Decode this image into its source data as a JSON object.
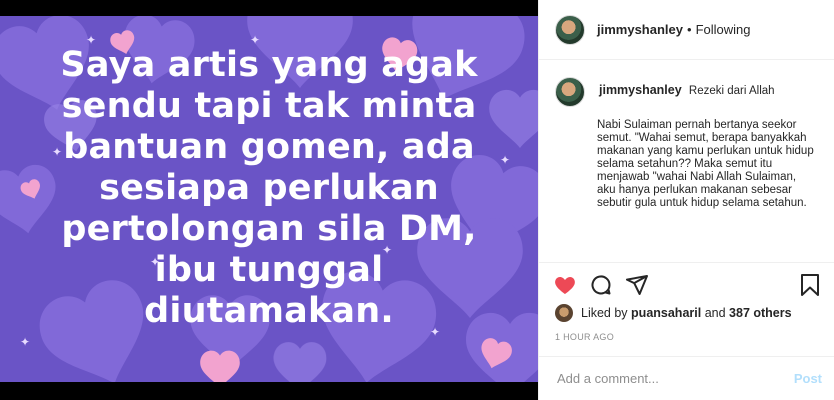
{
  "post": {
    "image_text": "Saya artis yang agak sendu tapi tak minta bantuan gomen, ada sesiapa perlukan pertolongan sila DM, ibu tunggal diutamakan.",
    "colors": {
      "background": "#6a54c6",
      "heart_light": "#8a72df",
      "heart_pink": "#f4a8d0",
      "text": "#ffffff"
    }
  },
  "header": {
    "username": "jimmyshanley",
    "separator": "•",
    "follow_status": "Following"
  },
  "caption": {
    "username": "jimmyshanley",
    "title": "Rezeki dari Allah",
    "body": "Nabi Sulaiman pernah bertanya seekor semut. \"Wahai semut, berapa banyakkah makanan yang kamu perlukan untuk hidup selama setahun?? Maka semut itu menjawab \"wahai Nabi Allah Sulaiman, aku hanya perlukan makanan sebesar sebutir gula untuk hidup selama setahun."
  },
  "actions": {
    "icons": [
      "heart-filled-icon",
      "comment-icon",
      "share-icon",
      "bookmark-icon"
    ],
    "like_color": "#ed4956"
  },
  "likes": {
    "prefix": "Liked by",
    "user": "puansaharil",
    "joiner": "and",
    "others": "387 others"
  },
  "timestamp": "1 HOUR AGO",
  "comment_box": {
    "placeholder": "Add a comment...",
    "post_label": "Post"
  }
}
